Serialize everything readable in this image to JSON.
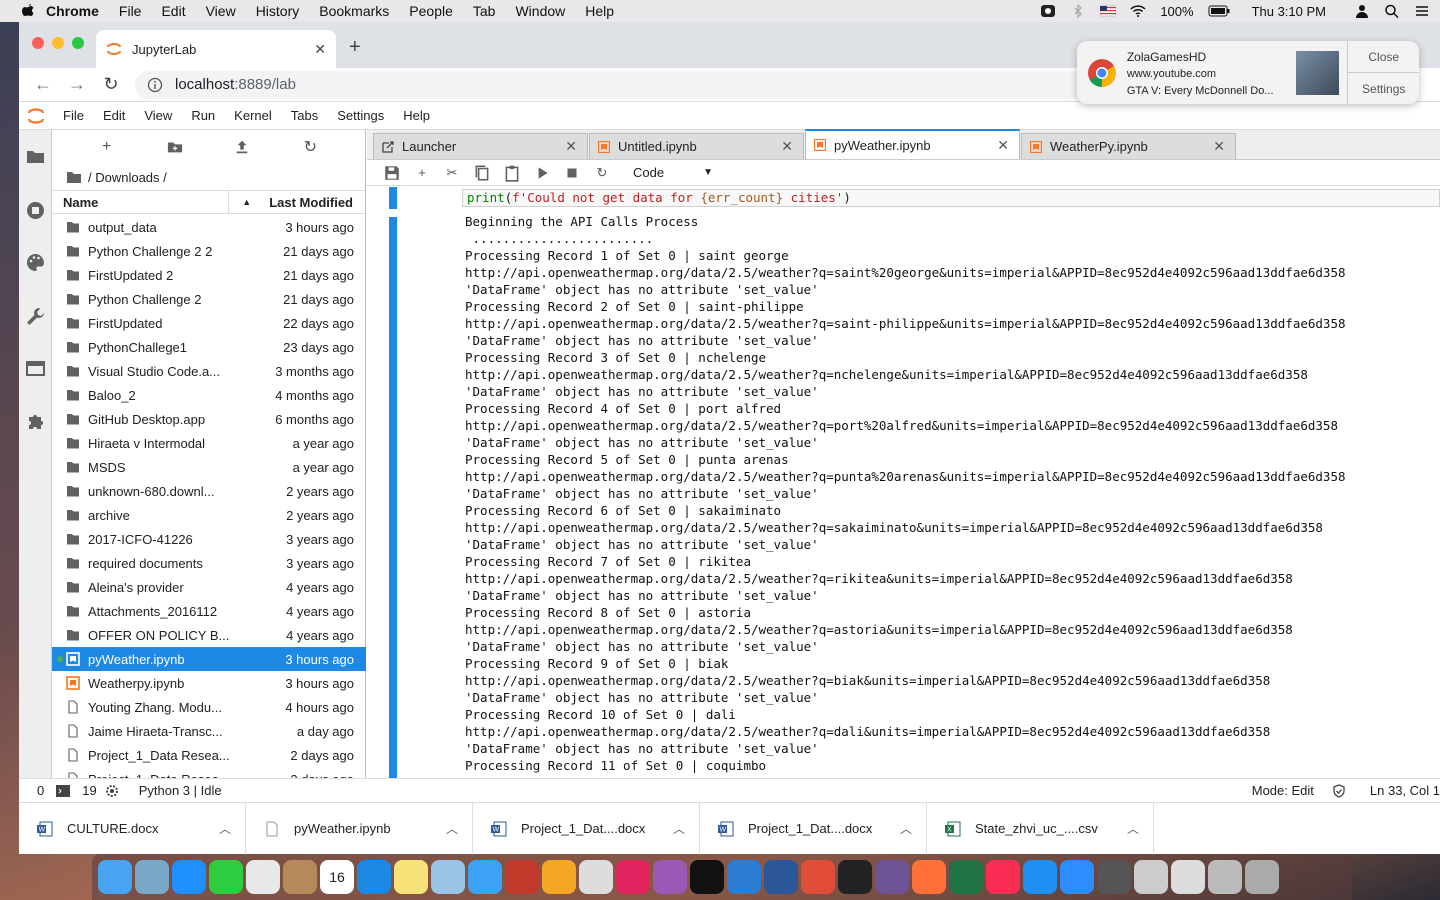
{
  "menubar": {
    "items": [
      "Chrome",
      "File",
      "Edit",
      "View",
      "History",
      "Bookmarks",
      "People",
      "Tab",
      "Window",
      "Help"
    ],
    "battery": "100%",
    "clock": "Thu 3:10 PM"
  },
  "browser": {
    "tab_title": "JupyterLab",
    "url_host": "localhost",
    "url_path": ":8889/lab"
  },
  "notification": {
    "title": "ZolaGamesHD",
    "site": "www.youtube.com",
    "body": "GTA V: Every McDonnell Do...",
    "close_label": "Close",
    "settings_label": "Settings"
  },
  "jupyter": {
    "menu": [
      "File",
      "Edit",
      "View",
      "Run",
      "Kernel",
      "Tabs",
      "Settings",
      "Help"
    ],
    "breadcrumb": "/ Downloads /",
    "header_name": "Name",
    "header_modified": "Last Modified",
    "files": [
      {
        "name": "output_data",
        "modified": "3 hours ago",
        "type": "folder"
      },
      {
        "name": "Python Challenge 2 2",
        "modified": "21 days ago",
        "type": "folder"
      },
      {
        "name": "FirstUpdated 2",
        "modified": "21 days ago",
        "type": "folder"
      },
      {
        "name": "Python Challenge 2",
        "modified": "21 days ago",
        "type": "folder"
      },
      {
        "name": "FirstUpdated",
        "modified": "22 days ago",
        "type": "folder"
      },
      {
        "name": "PythonChallege1",
        "modified": "23 days ago",
        "type": "folder"
      },
      {
        "name": "Visual Studio Code.a...",
        "modified": "3 months ago",
        "type": "folder"
      },
      {
        "name": "Baloo_2",
        "modified": "4 months ago",
        "type": "folder"
      },
      {
        "name": "GitHub Desktop.app",
        "modified": "6 months ago",
        "type": "folder"
      },
      {
        "name": "Hiraeta v Intermodal",
        "modified": "a year ago",
        "type": "folder"
      },
      {
        "name": "MSDS",
        "modified": "a year ago",
        "type": "folder"
      },
      {
        "name": "unknown-680.downl...",
        "modified": "2 years ago",
        "type": "folder"
      },
      {
        "name": "archive",
        "modified": "2 years ago",
        "type": "folder"
      },
      {
        "name": "2017-ICFO-41226",
        "modified": "3 years ago",
        "type": "folder"
      },
      {
        "name": "required documents",
        "modified": "3 years ago",
        "type": "folder"
      },
      {
        "name": "Aleina's provider",
        "modified": "4 years ago",
        "type": "folder"
      },
      {
        "name": "Attachments_2016112",
        "modified": "4 years ago",
        "type": "folder"
      },
      {
        "name": "OFFER ON POLICY B...",
        "modified": "4 years ago",
        "type": "folder"
      },
      {
        "name": "pyWeather.ipynb",
        "modified": "3 hours ago",
        "type": "notebook",
        "selected": true
      },
      {
        "name": "Weatherpy.ipynb",
        "modified": "3 hours ago",
        "type": "notebook"
      },
      {
        "name": "Youting Zhang. Modu...",
        "modified": "4 hours ago",
        "type": "file"
      },
      {
        "name": "Jaime Hiraeta-Transc...",
        "modified": "a day ago",
        "type": "file"
      },
      {
        "name": "Project_1_Data Resea...",
        "modified": "2 days ago",
        "type": "file"
      },
      {
        "name": "Project_1_Data Resea...",
        "modified": "2 days ago",
        "type": "file"
      }
    ],
    "tabs": [
      {
        "label": "Launcher",
        "icon": "launcher-icon"
      },
      {
        "label": "Untitled.ipynb",
        "icon": "notebook-icon"
      },
      {
        "label": "pyWeather.ipynb",
        "icon": "notebook-icon",
        "active": true
      },
      {
        "label": "WeatherPy.ipynb",
        "icon": "notebook-icon"
      }
    ],
    "cell_type": "Code",
    "code_line": {
      "fn": "print",
      "open": "(",
      "str": "f'Could not get data for ",
      "var": "{err_count}",
      "str_end": " cities'",
      "close": ")"
    },
    "output_lines": [
      "Beginning the API Calls Process",
      " ........................",
      "Processing Record 1 of Set 0 | saint george",
      "http://api.openweathermap.org/data/2.5/weather?q=saint%20george&units=imperial&APPID=8ec952d4e4092c596aad13ddfae6d358",
      "'DataFrame' object has no attribute 'set_value'",
      "Processing Record 2 of Set 0 | saint-philippe",
      "http://api.openweathermap.org/data/2.5/weather?q=saint-philippe&units=imperial&APPID=8ec952d4e4092c596aad13ddfae6d358",
      "'DataFrame' object has no attribute 'set_value'",
      "Processing Record 3 of Set 0 | nchelenge",
      "http://api.openweathermap.org/data/2.5/weather?q=nchelenge&units=imperial&APPID=8ec952d4e4092c596aad13ddfae6d358",
      "'DataFrame' object has no attribute 'set_value'",
      "Processing Record 4 of Set 0 | port alfred",
      "http://api.openweathermap.org/data/2.5/weather?q=port%20alfred&units=imperial&APPID=8ec952d4e4092c596aad13ddfae6d358",
      "'DataFrame' object has no attribute 'set_value'",
      "Processing Record 5 of Set 0 | punta arenas",
      "http://api.openweathermap.org/data/2.5/weather?q=punta%20arenas&units=imperial&APPID=8ec952d4e4092c596aad13ddfae6d358",
      "'DataFrame' object has no attribute 'set_value'",
      "Processing Record 6 of Set 0 | sakaiminato",
      "http://api.openweathermap.org/data/2.5/weather?q=sakaiminato&units=imperial&APPID=8ec952d4e4092c596aad13ddfae6d358",
      "'DataFrame' object has no attribute 'set_value'",
      "Processing Record 7 of Set 0 | rikitea",
      "http://api.openweathermap.org/data/2.5/weather?q=rikitea&units=imperial&APPID=8ec952d4e4092c596aad13ddfae6d358",
      "'DataFrame' object has no attribute 'set_value'",
      "Processing Record 8 of Set 0 | astoria",
      "http://api.openweathermap.org/data/2.5/weather?q=astoria&units=imperial&APPID=8ec952d4e4092c596aad13ddfae6d358",
      "'DataFrame' object has no attribute 'set_value'",
      "Processing Record 9 of Set 0 | biak",
      "http://api.openweathermap.org/data/2.5/weather?q=biak&units=imperial&APPID=8ec952d4e4092c596aad13ddfae6d358",
      "'DataFrame' object has no attribute 'set_value'",
      "Processing Record 10 of Set 0 | dali",
      "http://api.openweathermap.org/data/2.5/weather?q=dali&units=imperial&APPID=8ec952d4e4092c596aad13ddfae6d358",
      "'DataFrame' object has no attribute 'set_value'",
      "Processing Record 11 of Set 0 | coquimbo"
    ],
    "status": {
      "terminals": "0",
      "kernels": "19",
      "kernel_status": "Python 3 | Idle",
      "mode": "Mode: Edit",
      "cursor": "Ln 33, Col 1"
    }
  },
  "downloads": [
    {
      "name": "CULTURE.docx",
      "icon": "word-doc-icon"
    },
    {
      "name": "pyWeather.ipynb",
      "icon": "file-icon"
    },
    {
      "name": "Project_1_Dat....docx",
      "icon": "word-doc-icon"
    },
    {
      "name": "Project_1_Dat....docx",
      "icon": "word-doc-icon"
    },
    {
      "name": "State_zhvi_uc_....csv",
      "icon": "excel-csv-icon"
    }
  ],
  "colors": {
    "accent": "#1e88e5",
    "jupyter_orange": "#f37726"
  },
  "dock_apps": [
    "finder",
    "preview",
    "safari",
    "facetime",
    "chrome",
    "notes-books",
    "calendar",
    "app-store",
    "notes",
    "photos-preview",
    "messages",
    "photo-booth",
    "photos",
    "no-entry",
    "news",
    "podcasts",
    "apple-tv",
    "vscode",
    "word",
    "mail",
    "terminal",
    "github",
    "firefox",
    "excel",
    "music",
    "xcode",
    "zoom",
    "window-thumb-1",
    "window-thumb-2",
    "window-thumb-3",
    "window-thumb-4",
    "trash"
  ],
  "dock_date_label": "16"
}
